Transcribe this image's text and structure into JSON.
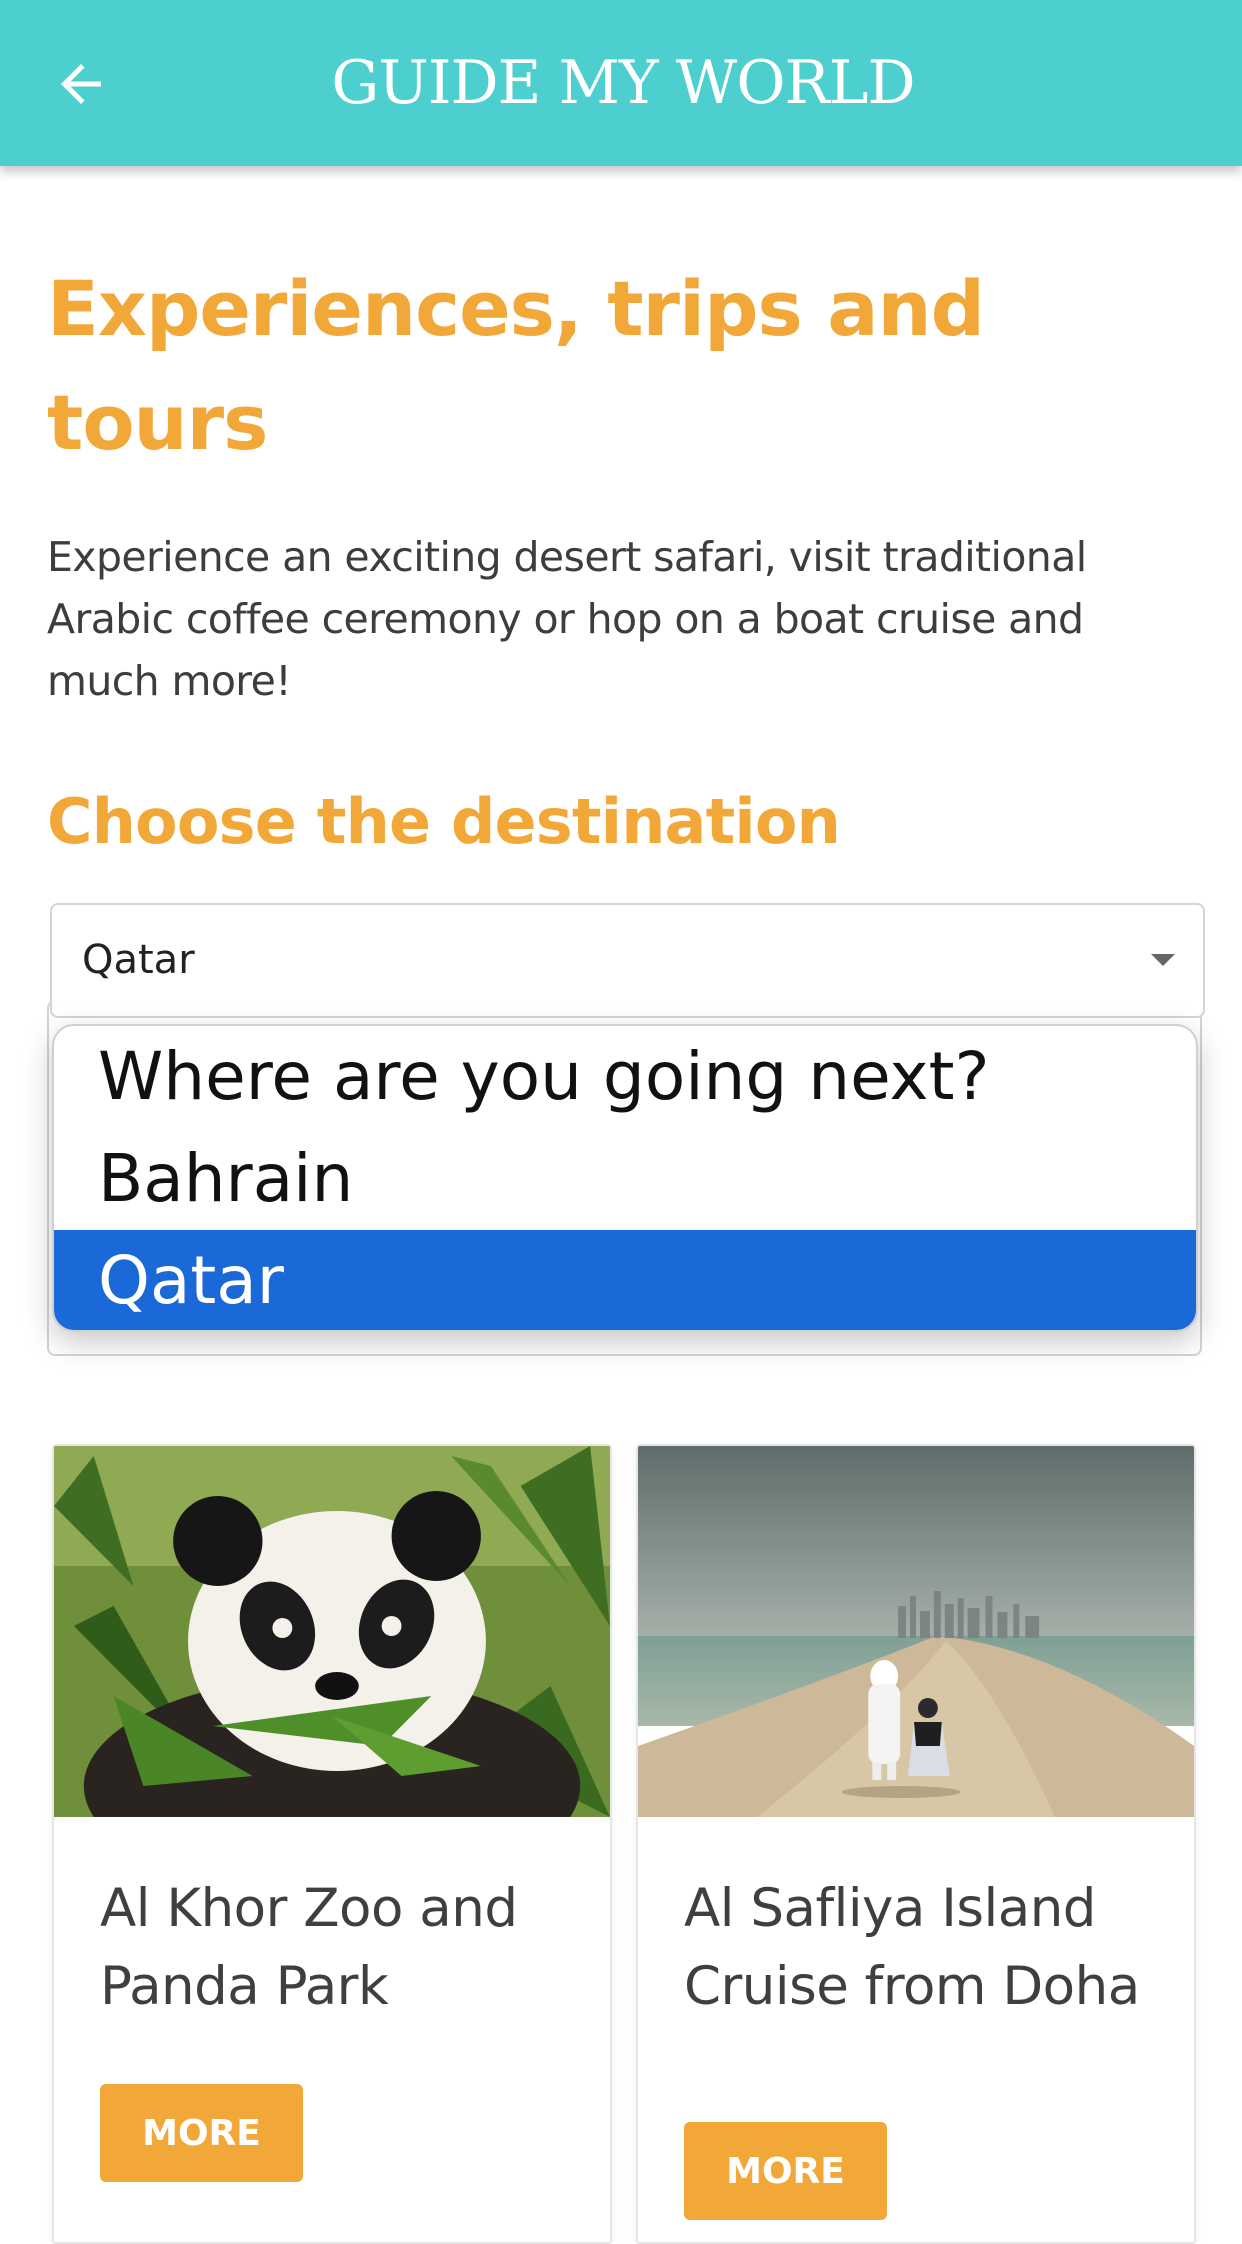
{
  "app_bar": {
    "title": "GUIDE MY WORLD",
    "back_icon": "arrow-left-icon",
    "background_color": "#4ecfcf"
  },
  "hero": {
    "title": "Experiences, trips and tours",
    "description": "Experience an exciting desert safari, visit traditional Arabic coffee ceremony or hop on a boat cruise and much more!"
  },
  "destination": {
    "section_title": "Choose the destination",
    "selected_value": "Qatar",
    "options": [
      "Where are you going next?",
      "Bahrain",
      "Qatar"
    ],
    "highlighted_option": "Qatar"
  },
  "cards": [
    {
      "title": "Al Khor Zoo and Panda Park",
      "button_label": "MORE",
      "image": "panda-photo"
    },
    {
      "title": "Al Safliya Island Cruise from Doha",
      "button_label": "MORE",
      "image": "beach-skyline-photo"
    }
  ],
  "colors": {
    "accent": "#f2a839",
    "teal": "#4ecfcf",
    "selection_blue": "#1b68d9"
  }
}
